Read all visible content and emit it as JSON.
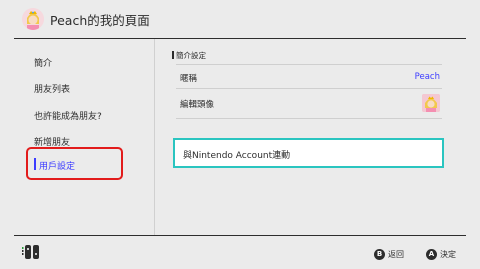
{
  "header": {
    "title": "Peach的我的頁面"
  },
  "sidebar": {
    "items": [
      {
        "label": "簡介"
      },
      {
        "label": "朋友列表"
      },
      {
        "label": "也許能成為朋友?"
      },
      {
        "label": "新增朋友"
      },
      {
        "label": "用戶設定"
      }
    ],
    "selected_index": 4
  },
  "main": {
    "section_title": "簡介設定",
    "nickname_label": "暱稱",
    "nickname_value": "Peach",
    "icon_label": "編輯頭像",
    "link_button_label": "與Nintendo Account連動"
  },
  "footer": {
    "back_key": "B",
    "back_label": "返回",
    "ok_key": "A",
    "ok_label": "決定"
  },
  "colors": {
    "accent": "#3c3cff",
    "highlight_outline": "#e21b1b",
    "focus_border": "#2ac5c0"
  }
}
